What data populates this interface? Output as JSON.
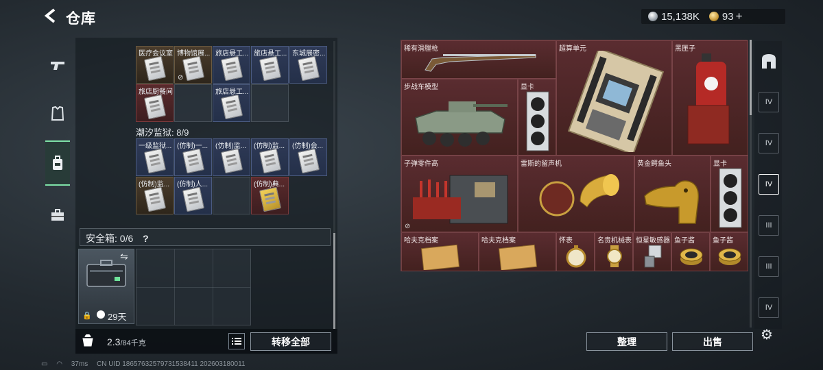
{
  "header": {
    "title": "仓库",
    "back_icon": "back-arrow-icon"
  },
  "currency": {
    "silver": "15,138K",
    "gold": "93",
    "plus": "+"
  },
  "left_nav": [
    {
      "icon": "pistol-icon"
    },
    {
      "icon": "armor-icon"
    },
    {
      "icon": "backpack-icon",
      "active": true
    },
    {
      "icon": "briefcase-icon"
    }
  ],
  "containers": {
    "group1_items": [
      {
        "label": "医疗会议室",
        "color": "brown"
      },
      {
        "label": "博物馆展...",
        "color": "brown",
        "no_icon": true
      },
      {
        "label": "旅店悬工...",
        "color": "blue"
      },
      {
        "label": "旅店悬工...",
        "color": "blue"
      },
      {
        "label": "东城展密...",
        "color": "blue"
      },
      {
        "label": "旅店厨餐间",
        "color": "red"
      },
      {
        "label": "",
        "color": "empty"
      },
      {
        "label": "旅店悬工...",
        "color": "blue"
      },
      {
        "label": "",
        "color": "empty"
      }
    ],
    "group2_title": "潮汐监狱: 8/9",
    "group2_items": [
      {
        "label": "一级监狱...",
        "color": "blue"
      },
      {
        "label": "(仿制)一...",
        "color": "blue"
      },
      {
        "label": "(仿制)监...",
        "color": "blue"
      },
      {
        "label": "(仿制)监...",
        "color": "blue"
      },
      {
        "label": "(仿制)会...",
        "color": "blue"
      },
      {
        "label": "(仿制)监...",
        "color": "brown"
      },
      {
        "label": "(仿制)人...",
        "color": "blue"
      },
      {
        "label": "",
        "color": "empty"
      },
      {
        "label": "(仿制)典...",
        "color": "red",
        "yellow": true
      }
    ]
  },
  "safe": {
    "label": "安全箱: 0/6",
    "help": "?",
    "days": "29天"
  },
  "weight": {
    "current": "2.3",
    "max": "/84",
    "unit": "千克"
  },
  "buttons": {
    "transfer_all": "转移全部",
    "organize": "整理",
    "sell": "出售"
  },
  "stash_items": [
    {
      "label": "稀有滑膛枪"
    },
    {
      "label": "超算单元"
    },
    {
      "label": "黑匣子"
    },
    {
      "label": "步战车模型"
    },
    {
      "label": "显卡"
    },
    {
      "label": "子弹零件高"
    },
    {
      "label": "雷斯的留声机"
    },
    {
      "label": "黄金鳄鱼头"
    },
    {
      "label": "显卡"
    },
    {
      "label": "哈夫克档案"
    },
    {
      "label": "哈夫克档案"
    },
    {
      "label": "怀表"
    },
    {
      "label": "名贵机械表"
    },
    {
      "label": "恒星敏感器"
    },
    {
      "label": "鱼子酱"
    },
    {
      "label": "鱼子酱"
    }
  ],
  "right_nav": [
    {
      "icon": "home-icon",
      "text": ""
    },
    {
      "icon": "tier-4-folder-icon",
      "text": "IV"
    },
    {
      "icon": "tier-4-camera-icon",
      "text": "IV"
    },
    {
      "icon": "tier-4-tv-icon",
      "text": "IV",
      "active": true
    },
    {
      "icon": "tier-3-image-icon",
      "text": "III"
    },
    {
      "icon": "tier-3-tool-icon",
      "text": "III"
    },
    {
      "icon": "tier-4-box-icon",
      "text": "IV"
    }
  ],
  "status_bar": {
    "ping": "37ms",
    "uid": "CN UID 18657632579731538411 202603180011"
  }
}
